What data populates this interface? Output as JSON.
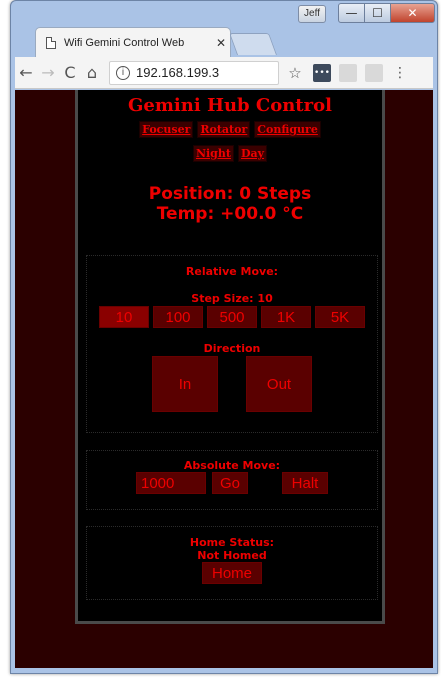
{
  "browser": {
    "tab_title": "Wifi Gemini Control Web",
    "tab_close": "✕",
    "profile_label": "Jeff",
    "win_min": "—",
    "win_max": "☐",
    "win_close": "✕",
    "url": "192.168.199.3",
    "icons": {
      "back": "←",
      "forward": "→",
      "reload": "C",
      "home": "⌂",
      "info": "i",
      "star": "☆",
      "menu": "⋮",
      "ext1": "•••"
    }
  },
  "page": {
    "title": "Gemini Hub Control",
    "nav": [
      "Focuser",
      "Rotator",
      "Configure"
    ],
    "nav2": [
      "Night",
      "Day"
    ],
    "position": "Position: 0 Steps",
    "temp": "Temp: +00.0 °C",
    "relative": {
      "heading": "Relative Move:",
      "step_size": "Step Size: 10",
      "steps": [
        "10",
        "100",
        "500",
        "1K",
        "5K"
      ],
      "selected_step": "10",
      "direction_label": "Direction",
      "in_label": "In",
      "out_label": "Out"
    },
    "absolute": {
      "heading": "Absolute Move:",
      "value": "1000",
      "go_label": "Go",
      "halt_label": "Halt"
    },
    "home": {
      "heading": "Home Status:",
      "status": "Not Homed",
      "button": "Home"
    }
  },
  "colors": {
    "accent_red": "#ee0000",
    "button_bg": "#5a0000",
    "page_bg": "#2b0000"
  }
}
